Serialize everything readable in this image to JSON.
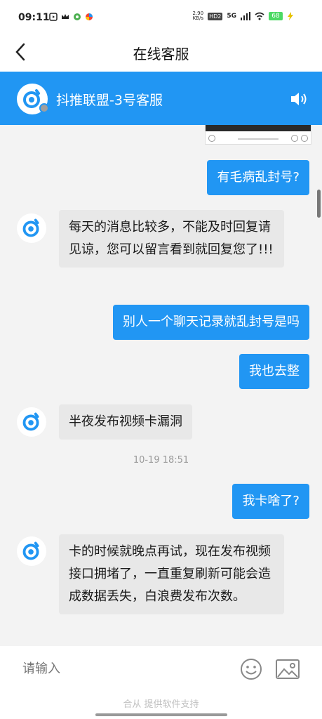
{
  "status_bar": {
    "time": "09:11",
    "net_speed_value": "2.90",
    "net_speed_unit": "KB/s",
    "hd_label": "HD",
    "hd_sub": "2",
    "signal_label": "5G",
    "battery": "68"
  },
  "nav": {
    "title": "在线客服"
  },
  "service_header": {
    "name": "抖推联盟-3号客服"
  },
  "messages": {
    "m1": "有毛病乱封号?",
    "m2": "每天的消息比较多，不能及时回复请见谅，您可以留言看到就回复您了!!!",
    "m3": "别人一个聊天记录就乱封号是吗",
    "m4": "我也去整",
    "m5": "半夜发布视频卡漏洞",
    "timestamp": "10-19 18:51",
    "m6": "我卡啥了?",
    "m7": "卡的时候就晚点再试，现在发布视频接口拥堵了，一直重复刷新可能会造成数据丢失，白浪费发布次数。"
  },
  "input": {
    "placeholder": "请输入",
    "powered_by": "合从 提供软件支持"
  },
  "colors": {
    "brand_blue": "#2196f3",
    "incoming_bubble": "#e8e8e8",
    "page_bg": "#f3f3f3"
  }
}
